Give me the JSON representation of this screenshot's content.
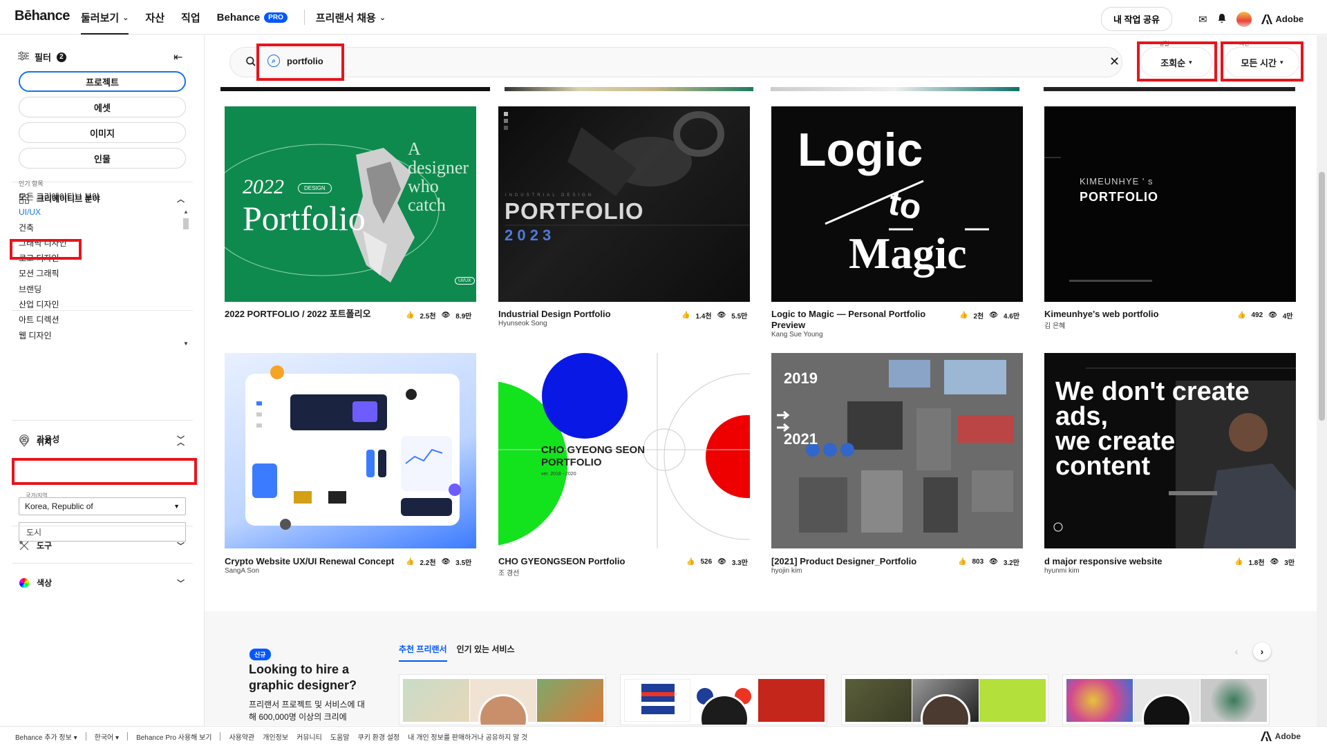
{
  "header": {
    "logo": "Bēhance",
    "nav": [
      "둘러보기",
      "자산",
      "직업",
      "Behance",
      "프리랜서 채용"
    ],
    "pro_badge": "PRO",
    "share_label": "내 작업 공유",
    "adobe_label": "Adobe"
  },
  "sidebar": {
    "filter_label": "필터",
    "filter_count": "2",
    "type_pills": [
      "프로젝트",
      "에셋",
      "이미지",
      "인물"
    ],
    "creative_title": "크리에이티브 분야",
    "popular_label": "인기 항목",
    "categories": [
      "모든 크리에이티브 분야",
      "UI/UX",
      "건축",
      "그래픽 디자인",
      "로고 디자인",
      "모션 그래픽",
      "브랜딩",
      "산업 디자인",
      "아트 디렉션",
      "웹 디자인"
    ],
    "availability_title": "가용성",
    "location_title": "위치",
    "country_label": "국가/지역",
    "country_value": "Korea, Republic of",
    "city_placeholder": "도시",
    "tools_title": "도구",
    "color_title": "색상"
  },
  "search": {
    "query": "portfolio",
    "sort_label": "정렬",
    "sort_value": "조회순",
    "time_label": "시간",
    "time_value": "모든 시간"
  },
  "projects": [
    {
      "title": "2022 PORTFOLIO / 2022 포트폴리오",
      "owner": "",
      "likes": "2.5천",
      "views": "8.9만"
    },
    {
      "title": "Industrial Design Portfolio",
      "owner": "Hyunseok Song",
      "likes": "1.4천",
      "views": "5.5만"
    },
    {
      "title": "Logic to Magic — Personal Portfolio Preview",
      "owner": "Kang Sue Young",
      "likes": "2천",
      "views": "4.6만"
    },
    {
      "title": "Kimeunhye's web portfolio",
      "owner": "김 은혜",
      "likes": "492",
      "views": "4만"
    },
    {
      "title": "Crypto Website UX/UI Renewal Concept",
      "owner": "SangA Son",
      "likes": "2.2천",
      "views": "3.5만"
    },
    {
      "title": "CHO GYEONGSEON Portfolio",
      "owner": "조 경선",
      "likes": "526",
      "views": "3.3만"
    },
    {
      "title": "[2021] Product Designer_Portfolio",
      "owner": "hyojin kim",
      "likes": "803",
      "views": "3.2만"
    },
    {
      "title": "d major responsive website",
      "owner": "hyunmi kim",
      "likes": "1.8천",
      "views": "3만"
    }
  ],
  "covers": {
    "c1": {
      "year": "2022",
      "word": "Portfolio",
      "badge": "DESIGN",
      "tagline": "A designer who catch",
      "tag": "UI/UX"
    },
    "c2": {
      "small": "INDUSTRIAL DESIGN",
      "word": "PORTFOLIO",
      "year": "2 0 2 3"
    },
    "c3": {
      "line1": "Logic",
      "line2": "to",
      "line3": "Magic"
    },
    "c4": {
      "line1": "KIMEUNHYE ' s",
      "line2": "PORTFOLIO"
    },
    "c6": {
      "line1": "CHO GYEONG SEON",
      "line2": "PORTFOLIO",
      "sub": "ver. 2018 - 2020"
    },
    "c7": {
      "y1": "2019",
      "y2": "2021"
    },
    "c8": {
      "line1": "We don't create",
      "line2": "ads,",
      "line3": "we create",
      "line4": "content"
    }
  },
  "hire": {
    "badge": "신규",
    "title": "Looking to hire a graphic designer?",
    "desc": "프리랜서 프로젝트 및 서비스에 대해 600,000명 이상의 크리에",
    "tabs": [
      "추천 프리랜서",
      "인기 있는 서비스"
    ]
  },
  "footer": {
    "items": [
      "Behance 추가 정보",
      "한국어",
      "Behance Pro 사용해 보기",
      "사용약관",
      "개인정보",
      "커뮤니티",
      "도움말",
      "쿠키 환경 설정",
      "내 개인 정보를 판매하거나 공유하지 말 것"
    ],
    "adobe": "Adobe"
  },
  "colors": {
    "accent": "#1473e6",
    "brand": "#0057ff",
    "highlight": "#e8141b"
  }
}
